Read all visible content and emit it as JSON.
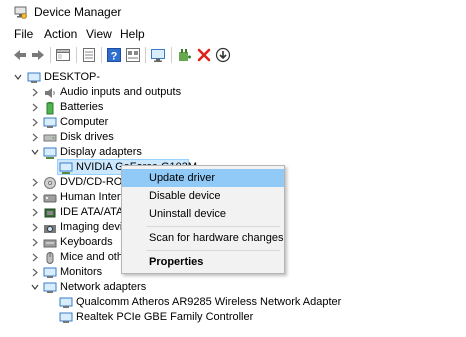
{
  "window": {
    "title": "Device Manager"
  },
  "menu": [
    "File",
    "Action",
    "View",
    "Help"
  ],
  "toolbar": {
    "buttons": [
      "back-icon",
      "forward-icon",
      "properties-pane-icon",
      "list-icon",
      "help-icon",
      "details-icon",
      "monitor-icon",
      "add-driver-icon",
      "uninstall-x-icon",
      "download-icon"
    ]
  },
  "tree": {
    "root": "DESKTOP-",
    "categories": [
      "Audio inputs and outputs",
      "Batteries",
      "Computer",
      "Disk drives",
      "Display adapters",
      "NVIDIA GeForce G103M",
      "DVD/CD-ROM",
      "Human Interf",
      "IDE ATA/ATAP",
      "Imaging devic",
      "Keyboards",
      "Mice and othe",
      "Monitors",
      "Network adapters",
      "Qualcomm Atheros AR9285 Wireless Network Adapter",
      "Realtek PCIe GBE Family Controller"
    ]
  },
  "context_menu": {
    "items": [
      "Update driver",
      "Disable device",
      "Uninstall device",
      "Scan for hardware changes",
      "Properties"
    ]
  },
  "colors": {
    "selection": "#cce8ff",
    "menu_highlight": "#91c9f7",
    "red_x": "#e0211b"
  }
}
